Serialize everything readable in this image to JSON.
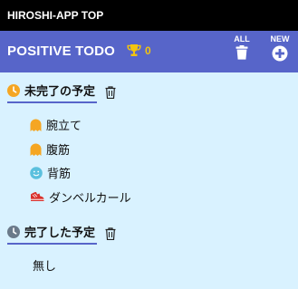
{
  "window": {
    "title": "HIROSHI-APP TOP"
  },
  "header": {
    "app_title": "POSITIVE TODO",
    "trophy_count": "0",
    "all_label": "ALL",
    "new_label": "NEW",
    "trophy_icon": "trophy-icon",
    "all_icon": "trash-icon",
    "new_icon": "plus-circle-icon"
  },
  "sections": {
    "open": {
      "title": "未完了の予定",
      "icon": "clock-icon",
      "icon_color": "#f5a623",
      "items": [
        {
          "label": "腕立て",
          "icon": "ghost-icon",
          "icon_color": "#f5a623"
        },
        {
          "label": "腹筋",
          "icon": "ghost-icon",
          "icon_color": "#f5a623"
        },
        {
          "label": "背筋",
          "icon": "smile-icon",
          "icon_color": "#5bc0de"
        },
        {
          "label": "ダンベルカール",
          "icon": "shoe-icon",
          "icon_color": "#d9302c"
        }
      ]
    },
    "done": {
      "title": "完了した予定",
      "icon": "clock-icon",
      "icon_color": "#6b7a8a",
      "empty_text": "無し"
    }
  },
  "colors": {
    "background": "#d9f2ff",
    "header": "#5765c9",
    "topbar": "#000000",
    "trophy": "#f2c40f"
  }
}
